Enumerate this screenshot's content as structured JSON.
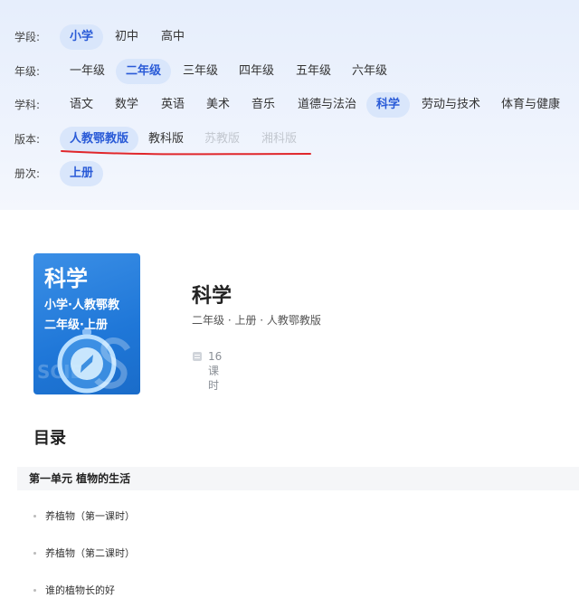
{
  "filters": {
    "stage": {
      "label": "学段:",
      "options": [
        "小学",
        "初中",
        "高中"
      ],
      "selected": "小学"
    },
    "grade": {
      "label": "年级:",
      "options": [
        "一年级",
        "二年级",
        "三年级",
        "四年级",
        "五年级",
        "六年级"
      ],
      "selected": "二年级"
    },
    "subject": {
      "label": "学科:",
      "options": [
        "语文",
        "数学",
        "英语",
        "美术",
        "音乐",
        "道德与法治",
        "科学",
        "劳动与技术",
        "体育与健康"
      ],
      "selected": "科学"
    },
    "edition": {
      "label": "版本:",
      "options": [
        "人教鄂教版",
        "教科版",
        "苏教版",
        "湘科版"
      ],
      "selected": "人教鄂教版",
      "disabled": [
        "苏教版",
        "湘科版"
      ]
    },
    "volume": {
      "label": "册次:",
      "options": [
        "上册"
      ],
      "selected": "上册"
    }
  },
  "colors": {
    "accent": "#2a5bd7",
    "chip_active_bg": "#d9e6fb",
    "annotation": "#e0262b",
    "cover": "#1f77d8"
  },
  "course": {
    "cover": {
      "title": "科学",
      "line1": "小学·人教鄂教",
      "line2": "二年级·上册",
      "watermark": "SCIE"
    },
    "title": "科学",
    "meta": "二年级 · 上册 · 人教鄂教版",
    "lessons": "16课时",
    "lessons_icon": "book-icon"
  },
  "toc": {
    "heading": "目录",
    "units": [
      {
        "title": "第一单元 植物的生活",
        "lessons": [
          "养植物（第一课时）",
          "养植物（第二课时）",
          "谁的植物长的好"
        ]
      }
    ]
  }
}
